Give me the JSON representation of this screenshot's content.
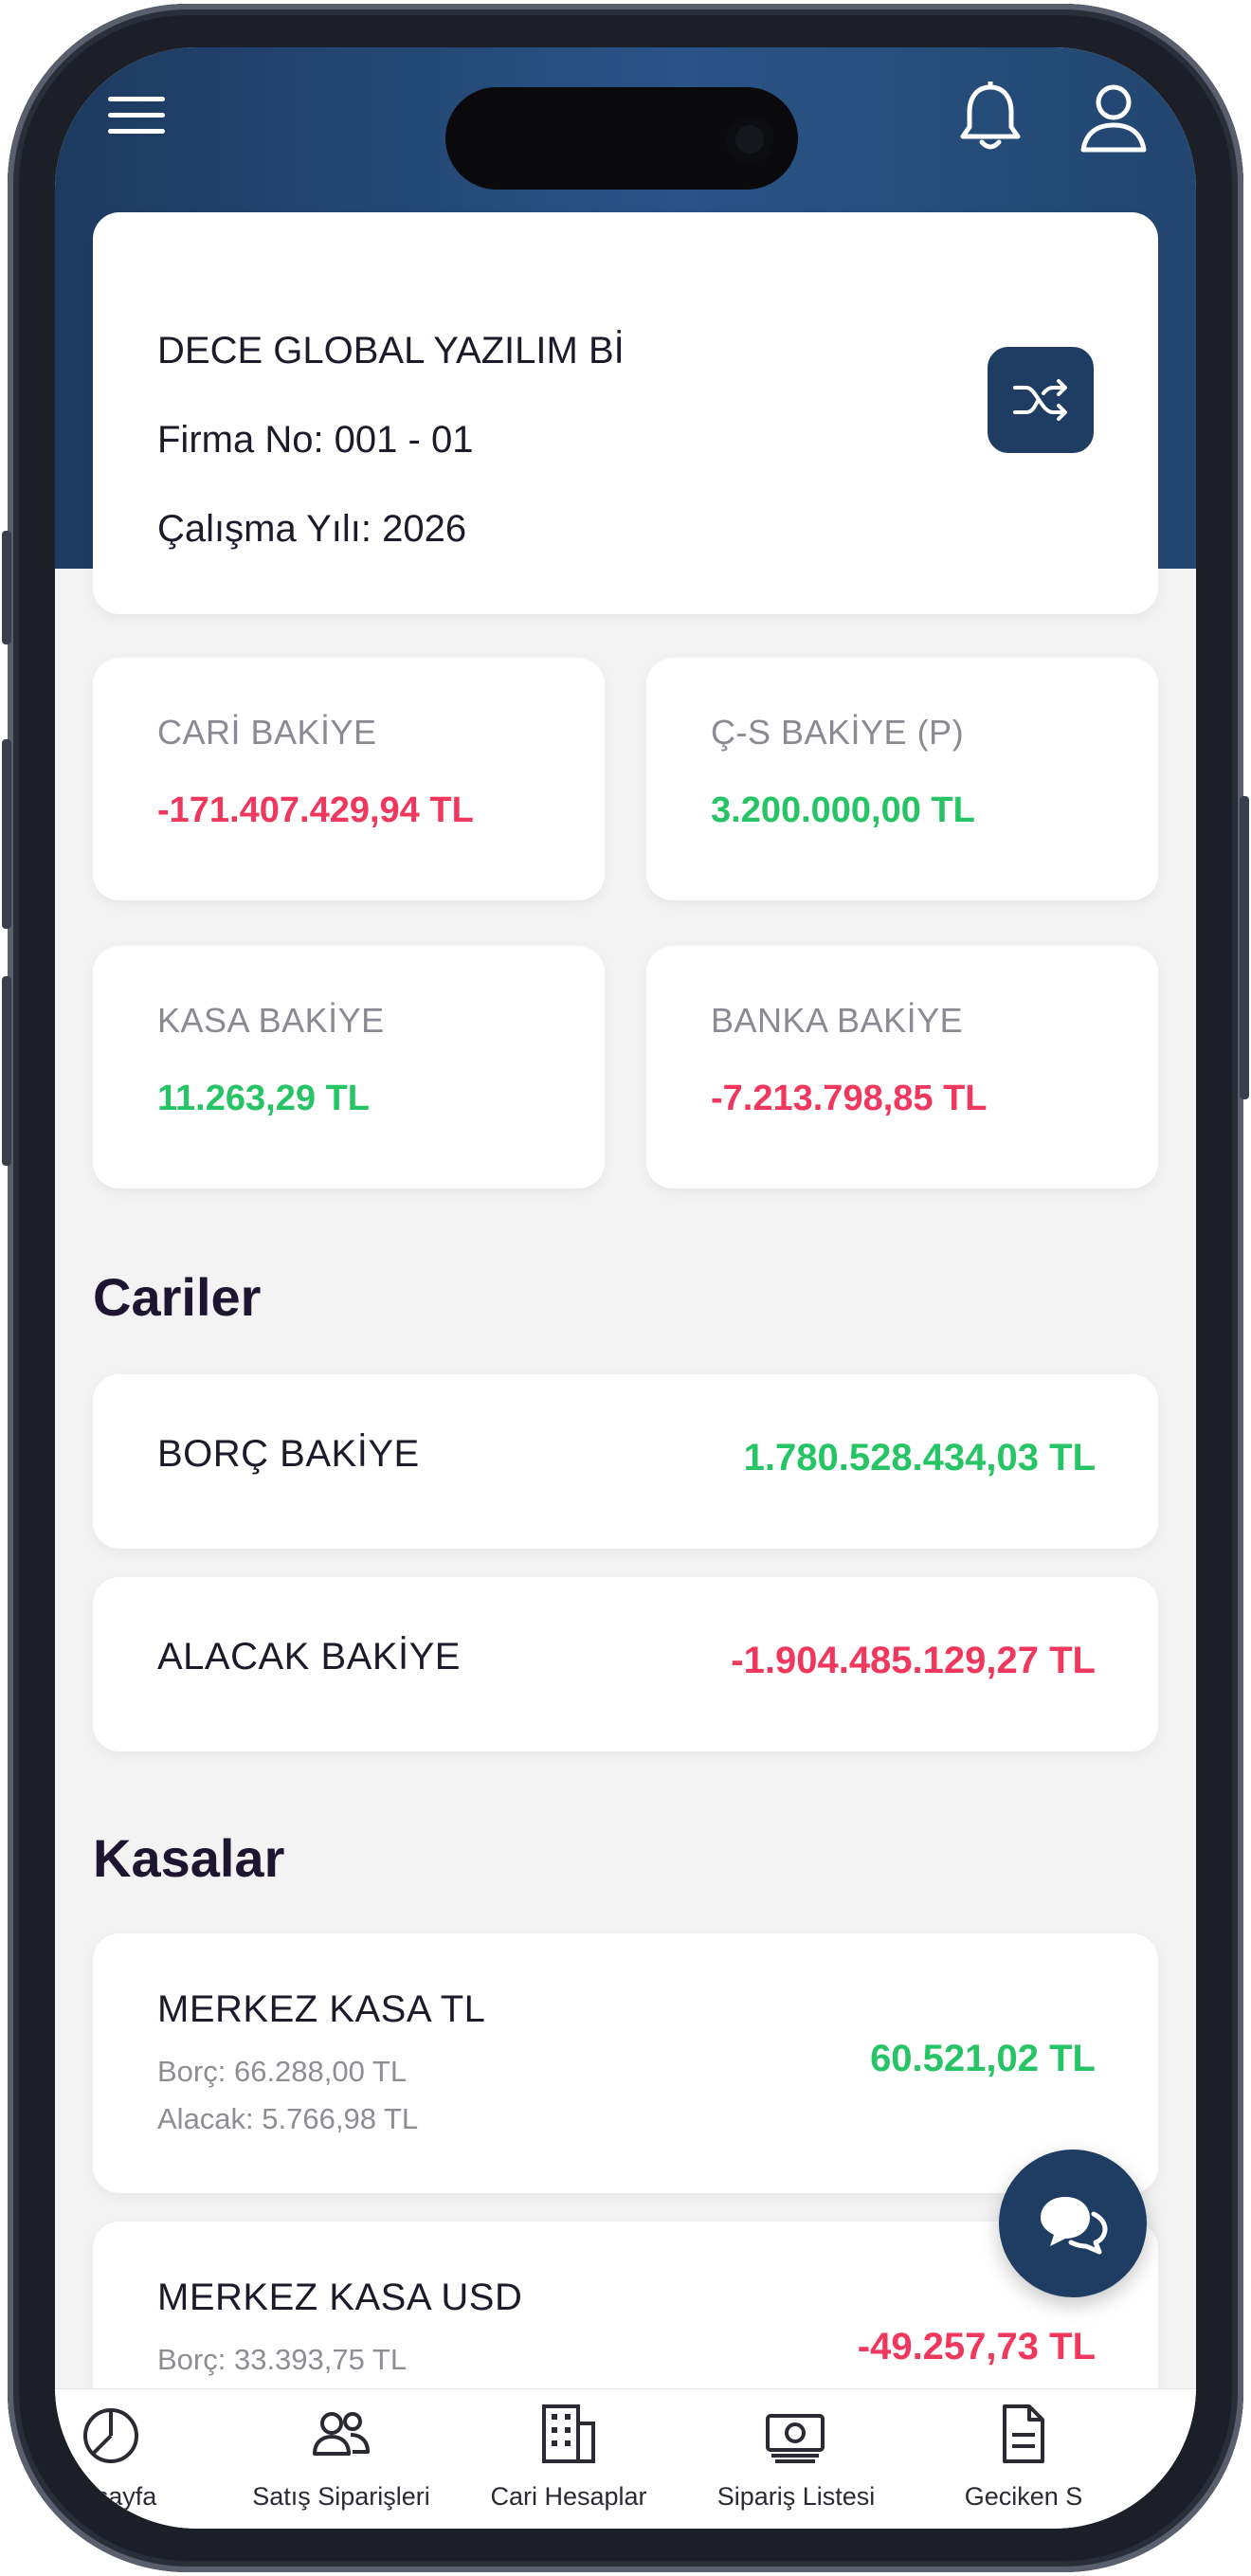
{
  "company": {
    "name": "DECE GLOBAL YAZILIM Bİ",
    "firm_no": "Firma No: 001 - 01",
    "year": "Çalışma Yılı: 2026"
  },
  "stats": [
    {
      "label": "CARİ BAKİYE",
      "value": "-171.407.429,94 TL",
      "status": "negative"
    },
    {
      "label": "Ç-S BAKİYE (P)",
      "value": "3.200.000,00 TL",
      "status": "positive"
    },
    {
      "label": "KASA BAKİYE",
      "value": "11.263,29 TL",
      "status": "positive"
    },
    {
      "label": "BANKA BAKİYE",
      "value": "-7.213.798,85 TL",
      "status": "negative"
    }
  ],
  "cariler": {
    "title": "Cariler",
    "items": [
      {
        "label": "BORÇ BAKİYE",
        "value": "1.780.528.434,03 TL",
        "status": "positive"
      },
      {
        "label": "ALACAK BAKİYE",
        "value": "-1.904.485.129,27 TL",
        "status": "negative"
      }
    ]
  },
  "kasalar": {
    "title": "Kasalar",
    "items": [
      {
        "name": "MERKEZ KASA TL",
        "borc": "Borç: 66.288,00 TL",
        "alacak": "Alacak: 5.766,98 TL",
        "value": "60.521,02 TL",
        "status": "positive"
      },
      {
        "name": "MERKEZ KASA USD",
        "borc": "Borç: 33.393,75 TL",
        "value": "-49.257,73 TL",
        "status": "negative"
      }
    ]
  },
  "nav": [
    {
      "label": "nasayfa",
      "icon": "pie-chart-icon"
    },
    {
      "label": "Satış Siparişleri",
      "icon": "users-icon"
    },
    {
      "label": "Cari Hesaplar",
      "icon": "building-icon"
    },
    {
      "label": "Sipariş Listesi",
      "icon": "money-icon"
    },
    {
      "label": "Geciken S",
      "icon": "document-icon"
    }
  ],
  "colors": {
    "header": "#1f3c62",
    "negative": "#f0385e",
    "positive": "#27c466"
  }
}
